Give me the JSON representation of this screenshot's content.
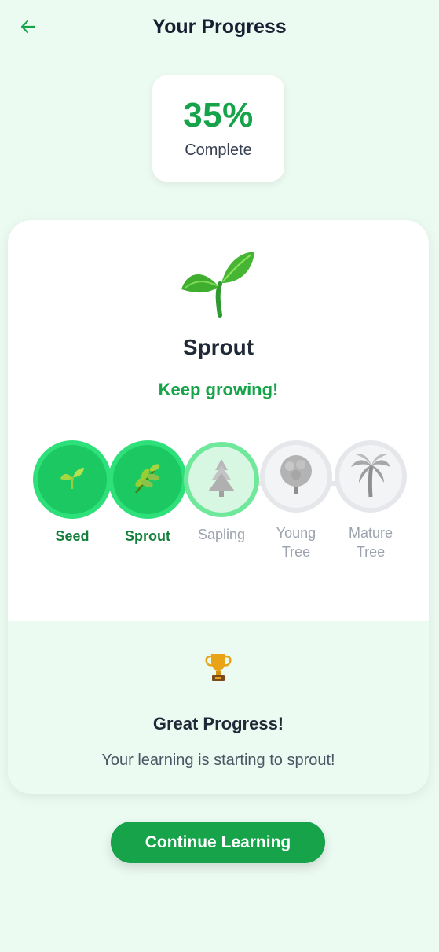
{
  "header": {
    "title": "Your Progress",
    "back_icon": "arrow-left-icon"
  },
  "progress": {
    "percent_text": "35%",
    "percent_value": 35,
    "label": "Complete"
  },
  "current_stage": {
    "name": "Sprout",
    "message": "Keep growing!",
    "icon": "seedling-icon"
  },
  "stages": [
    {
      "label": "Seed",
      "status": "done",
      "icon": "seedling-icon"
    },
    {
      "label": "Sprout",
      "status": "done",
      "icon": "herb-icon"
    },
    {
      "label": "Sapling",
      "status": "current",
      "icon": "evergreen-tree-icon"
    },
    {
      "label": "Young Tree",
      "status": "locked",
      "icon": "deciduous-tree-icon"
    },
    {
      "label": "Mature Tree",
      "status": "locked",
      "icon": "palm-tree-icon"
    }
  ],
  "achievement": {
    "icon": "trophy-icon",
    "title": "Great Progress!",
    "text": "Your learning is starting to sprout!"
  },
  "continue_button": {
    "label": "Continue Learning"
  },
  "colors": {
    "accent": "#16a34a",
    "stage_done": "#1bc862",
    "background": "#ecfbf2"
  }
}
